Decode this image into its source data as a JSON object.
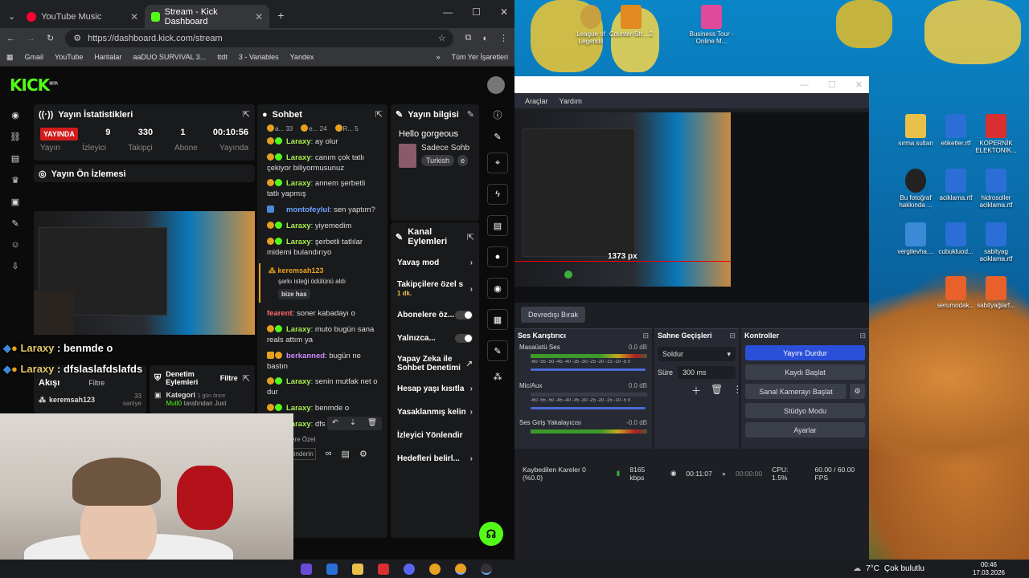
{
  "browser": {
    "tabs": [
      {
        "title": "YouTube Music",
        "color": "#ff0033"
      },
      {
        "title": "Stream - Kick Dashboard",
        "color": "#53fc18"
      }
    ],
    "url": "https://dashboard.kick.com/stream",
    "bookmarks": [
      "Gmail",
      "YouTube",
      "Haritalar",
      "aaDUO SURVIVAL 3...",
      "ttdt",
      "3 - Variables",
      "Yandex",
      "Tüm Yer İşaretleri"
    ]
  },
  "kick": {
    "logo": "KICK",
    "logo_tag": "BETA",
    "stats_panel": {
      "title": "Yayın İstatistikleri",
      "live_badge": "YAYINDA",
      "values": [
        "9",
        "330",
        "1",
        "00:10:56"
      ],
      "labels": [
        "Yayın",
        "İzleyici",
        "Takipçi",
        "Abone",
        "Yayında"
      ]
    },
    "preview_panel": {
      "title": "Yayın Ön İzlemesi"
    },
    "chat_panel": {
      "title": "Sohbet",
      "top_users": [
        {
          "name": "a...",
          "count": "33"
        },
        {
          "name": "e...",
          "count": "24"
        },
        {
          "name": "R...",
          "count": "5"
        }
      ],
      "messages": [
        {
          "user": "Laraxy",
          "text": "ay olur",
          "color": "#a7ef4a"
        },
        {
          "user": "Laraxy",
          "text": "canım çok tatlı çekiyor biliyormusunuz",
          "color": "#a7ef4a"
        },
        {
          "user": "Laraxy",
          "text": "annem şerbetli tatlı yapmış",
          "color": "#a7ef4a"
        },
        {
          "user": "montofeylul",
          "text": "sen yaptım?",
          "color": "#6aa3ff"
        },
        {
          "user": "Laraxy",
          "text": "yiyemedim",
          "color": "#a7ef4a"
        },
        {
          "user": "Laraxy",
          "text": "şerbetli tatlılar midemi bulandırıyo",
          "color": "#a7ef4a"
        }
      ],
      "reward": {
        "user": "keremsah123",
        "text": "şarkı isteği ödülünü aldı",
        "chip": "bize has"
      },
      "messages2": [
        {
          "user": "fearent",
          "text": "soner kabadayı o",
          "color": "#ff6b6b"
        },
        {
          "user": "Laraxy",
          "text": "muto bugün sana reals attım ya",
          "color": "#a7ef4a"
        },
        {
          "user": "berkanned",
          "text": "bugün ne bastın",
          "color": "#c88cff"
        },
        {
          "user": "Laraxy",
          "text": "senin mutfak net o dur",
          "color": "#a7ef4a"
        },
        {
          "user": "Laraxy",
          "text": "benmde o",
          "color": "#a7ef4a"
        },
        {
          "user": "Laraxy",
          "text": "dfs",
          "color": "#a7ef4a"
        }
      ],
      "footer_hint": "ere Özel",
      "send_label": "önderin"
    },
    "stream_info": {
      "title": "Yayın bilgisi",
      "stream_title": "Hello gorgeous",
      "category": "Sadece Sohb",
      "tag": "Turkish",
      "tag2": "e"
    },
    "channel_actions": {
      "title": "Kanal Eylemleri",
      "rows": [
        {
          "label": "Yavaş mod",
          "type": "arrow"
        },
        {
          "label": "Takipçilere özel s",
          "sub": "1 dk.",
          "type": "arrow"
        },
        {
          "label": "Abonelere öz...",
          "type": "toggle"
        },
        {
          "label": "Yalnızca...",
          "type": "toggle"
        },
        {
          "label": "Yapay Zeka ile Sohbet Denetimi",
          "type": "link"
        },
        {
          "label": "Hesap yaşı kısıtla",
          "type": "arrow"
        },
        {
          "label": "Yasaklanmış kelin",
          "type": "arrow"
        },
        {
          "label": "İzleyici Yönlendir",
          "type": "none"
        },
        {
          "label": "Hedefleri belirl...",
          "type": "arrow"
        }
      ]
    },
    "activity_panel": {
      "title": "Akışı",
      "filter": "Filtre",
      "user": "keremsah123",
      "count": "33",
      "unit": "saniye"
    },
    "moderation_panel": {
      "title": "Denetim Eylemleri",
      "filter": "Filtre",
      "item_title": "Kategori",
      "item_time": "1 gün önce",
      "item_user": "Mutl0",
      "item_text": "tarafından Just"
    },
    "overlay": [
      {
        "user": "Laraxy",
        "text": " : benmde o"
      },
      {
        "user": "Laraxy",
        "text": " : dfslaslafdslafds"
      }
    ]
  },
  "obs": {
    "menu": [
      "Araçlar",
      "Yardım"
    ],
    "preview_label": "1373 px",
    "transition_button": "Devredışı Bırak",
    "mixer": {
      "title": "Ses Karıştırıcı",
      "channels": [
        {
          "name": "Masaüstü Ses",
          "db": "0.0 dB"
        },
        {
          "name": "Mic/Aux",
          "db": "0.0 dB"
        },
        {
          "name": "Ses Giriş Yakalayıcısı",
          "db": "-0.0 dB"
        }
      ],
      "scale": "-60 -55 -50 -45 -40 -35 -30 -25 -20 -15 -10 -5 0"
    },
    "transitions": {
      "title": "Sahne Geçişleri",
      "selected": "Soldur",
      "duration_label": "Süre",
      "duration": "300 ms"
    },
    "controls": {
      "title": "Kontroller",
      "buttons": [
        "Yayını Durdur",
        "Kaydı Başlat",
        "Sanal Kamerayı Başlat",
        "Stüdyo Modu",
        "Ayarlar"
      ]
    },
    "status": {
      "dropped": "Kaybedilen Kareler 0 (%0.0)",
      "bitrate": "8165 kbps",
      "stream_time": "00:11:07",
      "rec_time": "00:00:00",
      "cpu": "CPU: 1.5%",
      "fps": "60.00 / 60.00 FPS"
    }
  },
  "desktop": {
    "icons": [
      {
        "label": "League of Legends",
        "color": "#c8a040"
      },
      {
        "label": "Counter-Str... 2",
        "color": "#e08a20"
      },
      {
        "label": "Business Tour - Online M...",
        "color": "#e04a9a"
      },
      {
        "label": "sırma sultan",
        "color": "#e8c04a"
      },
      {
        "label": "etiketler.rtf",
        "color": "#2b6fd6"
      },
      {
        "label": "KOPERNİK ELEKTONİK...",
        "color": "#d83030"
      },
      {
        "label": "Bu fotoğraf hakkında ...",
        "color": "#222"
      },
      {
        "label": "aciklama.rtf",
        "color": "#2b6fd6"
      },
      {
        "label": "hidrosoller aciklama.rtf",
        "color": "#2b6fd6"
      },
      {
        "label": "vergilevha....",
        "color": "#3a8ad8"
      },
      {
        "label": "cubukluod...",
        "color": "#2b6fd6"
      },
      {
        "label": "sabityag aciklama.rtf",
        "color": "#2b6fd6"
      },
      {
        "label": "serumodak...",
        "color": "#e8602a"
      },
      {
        "label": "sabityağlarf...",
        "color": "#e8602a"
      }
    ]
  },
  "taskbar": {
    "weather": "7°C",
    "weather_text": "Çok bulutlu",
    "time": "00:46",
    "date": "17.03.2026"
  }
}
